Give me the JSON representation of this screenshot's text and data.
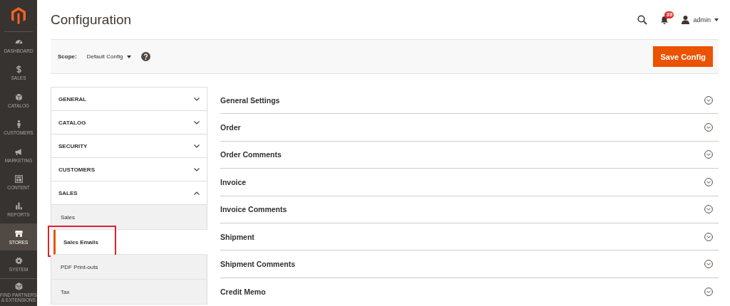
{
  "sidebar": {
    "items": [
      {
        "label": "DASHBOARD",
        "kind": "gauge",
        "selected": false
      },
      {
        "label": "SALES",
        "kind": "dollar",
        "selected": false
      },
      {
        "label": "CATALOG",
        "kind": "box",
        "selected": false
      },
      {
        "label": "CUSTOMERS",
        "kind": "person",
        "selected": false
      },
      {
        "label": "MARKETING",
        "kind": "megaphone",
        "selected": false
      },
      {
        "label": "CONTENT",
        "kind": "layout",
        "selected": false
      },
      {
        "label": "REPORTS",
        "kind": "bars",
        "selected": false
      },
      {
        "label": "STORES",
        "kind": "store",
        "selected": true
      },
      {
        "label": "SYSTEM",
        "kind": "gear",
        "selected": false
      },
      {
        "label": "FIND PARTNERS & EXTENSIONS",
        "kind": "cubes",
        "selected": false
      }
    ]
  },
  "header": {
    "title": "Configuration",
    "notification_count": "39",
    "user": "admin"
  },
  "scope": {
    "label": "Scope:",
    "value": "Default Config"
  },
  "save_button": "Save Config",
  "config_nav": [
    {
      "label": "GENERAL",
      "expanded": false
    },
    {
      "label": "CATALOG",
      "expanded": false
    },
    {
      "label": "SECURITY",
      "expanded": false
    },
    {
      "label": "CUSTOMERS",
      "expanded": false
    },
    {
      "label": "SALES",
      "expanded": true,
      "children": [
        {
          "label": "Sales",
          "selected": false,
          "highlighted": false
        },
        {
          "label": "Sales Emails",
          "selected": true,
          "highlighted": true
        },
        {
          "label": "PDF Print-outs",
          "selected": false,
          "highlighted": false
        },
        {
          "label": "Tax",
          "selected": false,
          "highlighted": false
        }
      ]
    }
  ],
  "sections": [
    {
      "title": "General Settings",
      "expanded": false
    },
    {
      "title": "Order",
      "expanded": false
    },
    {
      "title": "Order Comments",
      "expanded": false
    },
    {
      "title": "Invoice",
      "expanded": false
    },
    {
      "title": "Invoice Comments",
      "expanded": false
    },
    {
      "title": "Shipment",
      "expanded": false
    },
    {
      "title": "Shipment Comments",
      "expanded": false
    },
    {
      "title": "Credit Memo",
      "expanded": false
    }
  ]
}
